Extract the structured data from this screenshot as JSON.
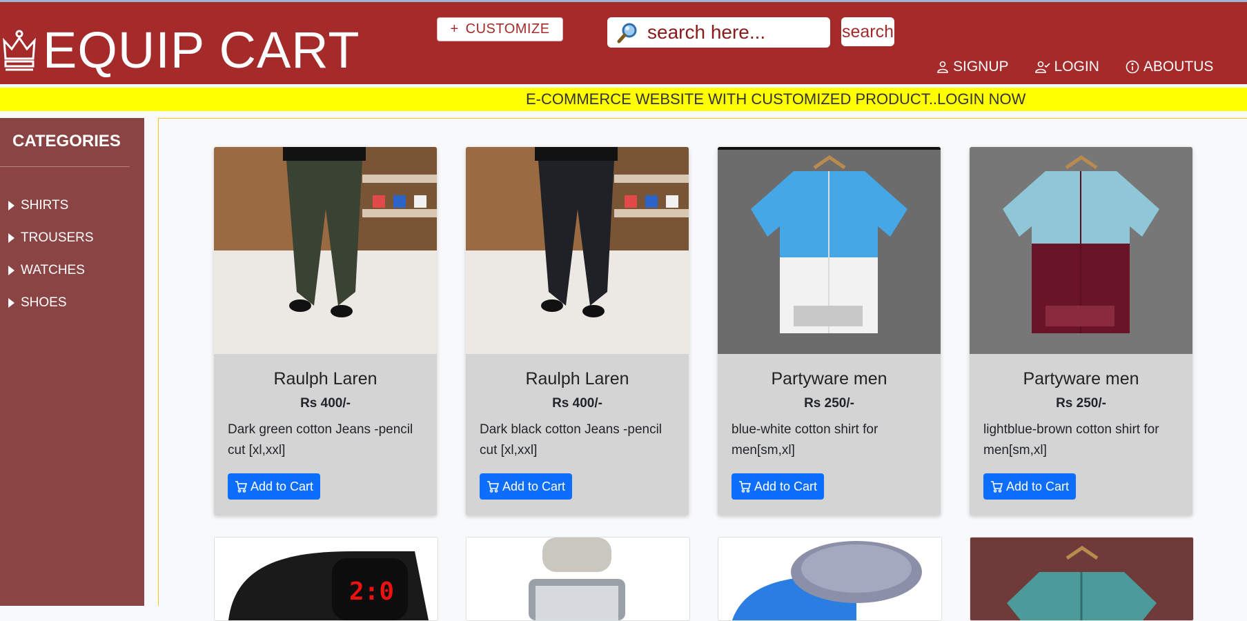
{
  "brand": {
    "title": "EQUIP CART",
    "icon": "crown-icon"
  },
  "header": {
    "customize_label": "CUSTOMIZE",
    "search_placeholder": "search here...",
    "search_button": "search",
    "nav": [
      {
        "label": "SIGNUP",
        "icon": "user-icon"
      },
      {
        "label": "LOGIN",
        "icon": "user-check-icon"
      },
      {
        "label": "ABOUTUS",
        "icon": "info-icon"
      }
    ]
  },
  "marquee": {
    "text": "E-COMMERCE WEBSITE WITH CUSTOMIZED PRODUCT..LOGIN NOW"
  },
  "sidebar": {
    "title": "CATEGORIES",
    "items": [
      "SHIRTS",
      "TROUSERS",
      "WATCHES",
      "SHOES"
    ]
  },
  "products": [
    {
      "name": "Raulph Laren",
      "price": "Rs 400/-",
      "desc": "Dark green cotton Jeans -pencil cut [xl,xxl]",
      "button": "Add to Cart",
      "color": "#3a4233"
    },
    {
      "name": "Raulph Laren",
      "price": "Rs 400/-",
      "desc": "Dark black cotton Jeans -pencil cut [xl,xxl]",
      "button": "Add to Cart",
      "color": "#1f2126"
    },
    {
      "name": "Partyware men",
      "price": "Rs 250/-",
      "desc": "blue-white cotton shirt for men[sm,xl]",
      "button": "Add to Cart",
      "color": "#45a7e6"
    },
    {
      "name": "Partyware men",
      "price": "Rs 250/-",
      "desc": "lightblue-brown cotton shirt for men[sm,xl]",
      "button": "Add to Cart",
      "color": "#8fc7d8"
    }
  ],
  "colors": {
    "header": "#a52a2a",
    "marquee": "#ffff00",
    "sidebar": "#8b4444",
    "button": "#0d6efd"
  }
}
